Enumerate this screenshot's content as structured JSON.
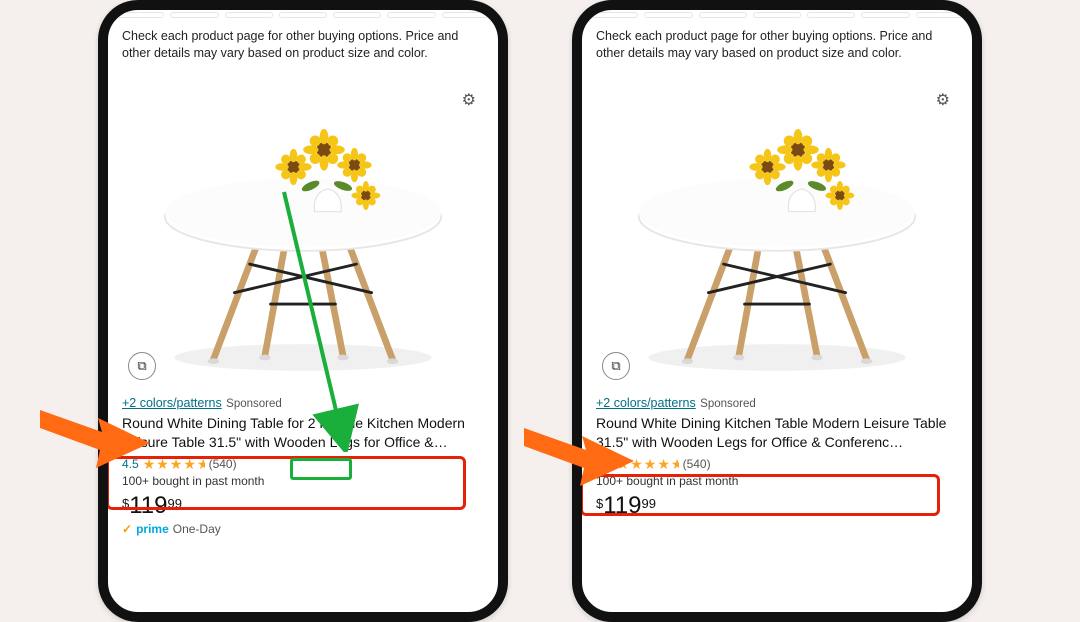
{
  "notice_text": "Check each product page for other buying options. Price and other details may vary based on product size and color.",
  "colors_link": "+2 colors/patterns",
  "sponsored_label": "Sponsored",
  "rating": {
    "value": "4.5",
    "count": "(540)"
  },
  "bought_text": "100+ bought in past month",
  "price": {
    "currency": "$",
    "whole": "119",
    "cents": "99"
  },
  "prime": {
    "check": "✓",
    "label": "prime",
    "delivery": "One-Day"
  },
  "swatch_glyph": "⧉",
  "gear_glyph": "⚙",
  "left": {
    "title": "Round White Dining Table for 2 People Kitchen Modern Leisure Table 31.5\" with Wooden Legs for Office &…",
    "highlight_text": "2 People"
  },
  "right": {
    "title": "Round White Dining Kitchen Table Modern Leisure Table 31.5\" with Wooden Legs for Office & Conferenc…"
  }
}
